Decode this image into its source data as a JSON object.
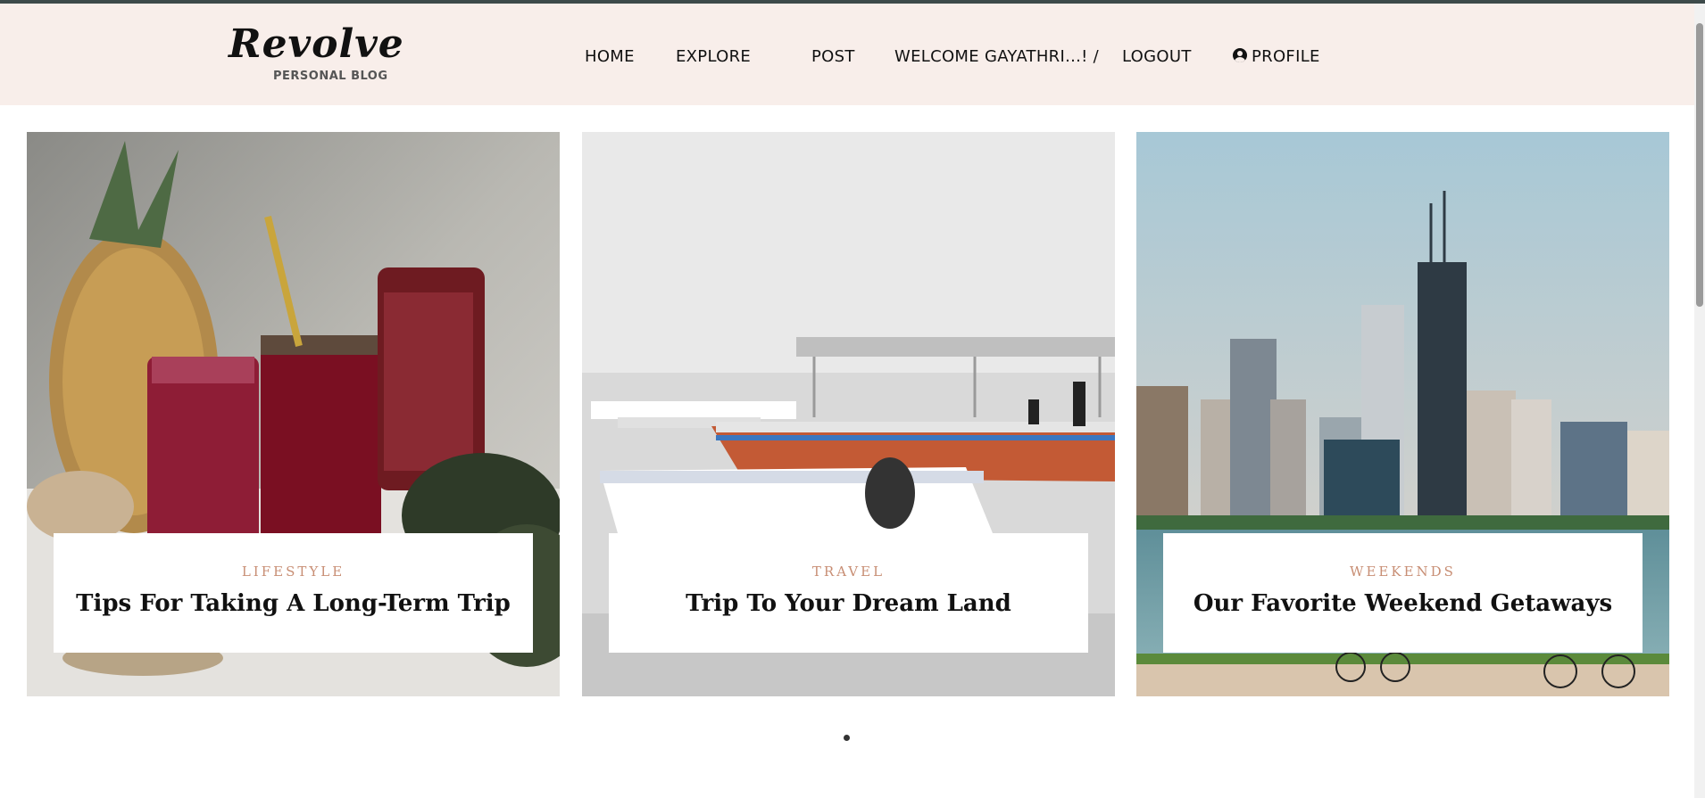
{
  "brand": {
    "name": "Revolve",
    "tagline": "PERSONAL BLOG"
  },
  "nav": {
    "home": "HOME",
    "explore": "EXPLORE",
    "post": "POST",
    "welcome": "WELCOME GAYATHRI...! /",
    "logout": "LOGOUT",
    "profile": "PROFILE",
    "profile_icon": "user-circle-icon"
  },
  "slides": [
    {
      "category": "LIFESTYLE",
      "title": "Tips For Taking A Long-Term Trip"
    },
    {
      "category": "TRAVEL",
      "title": "Trip To Your Dream Land"
    },
    {
      "category": "WEEKENDS",
      "title": "Our Favorite Weekend Getaways"
    }
  ],
  "colors": {
    "header_bg": "#f8eeea",
    "category_accent": "#c88e74",
    "top_rule": "#3d4a4a"
  }
}
